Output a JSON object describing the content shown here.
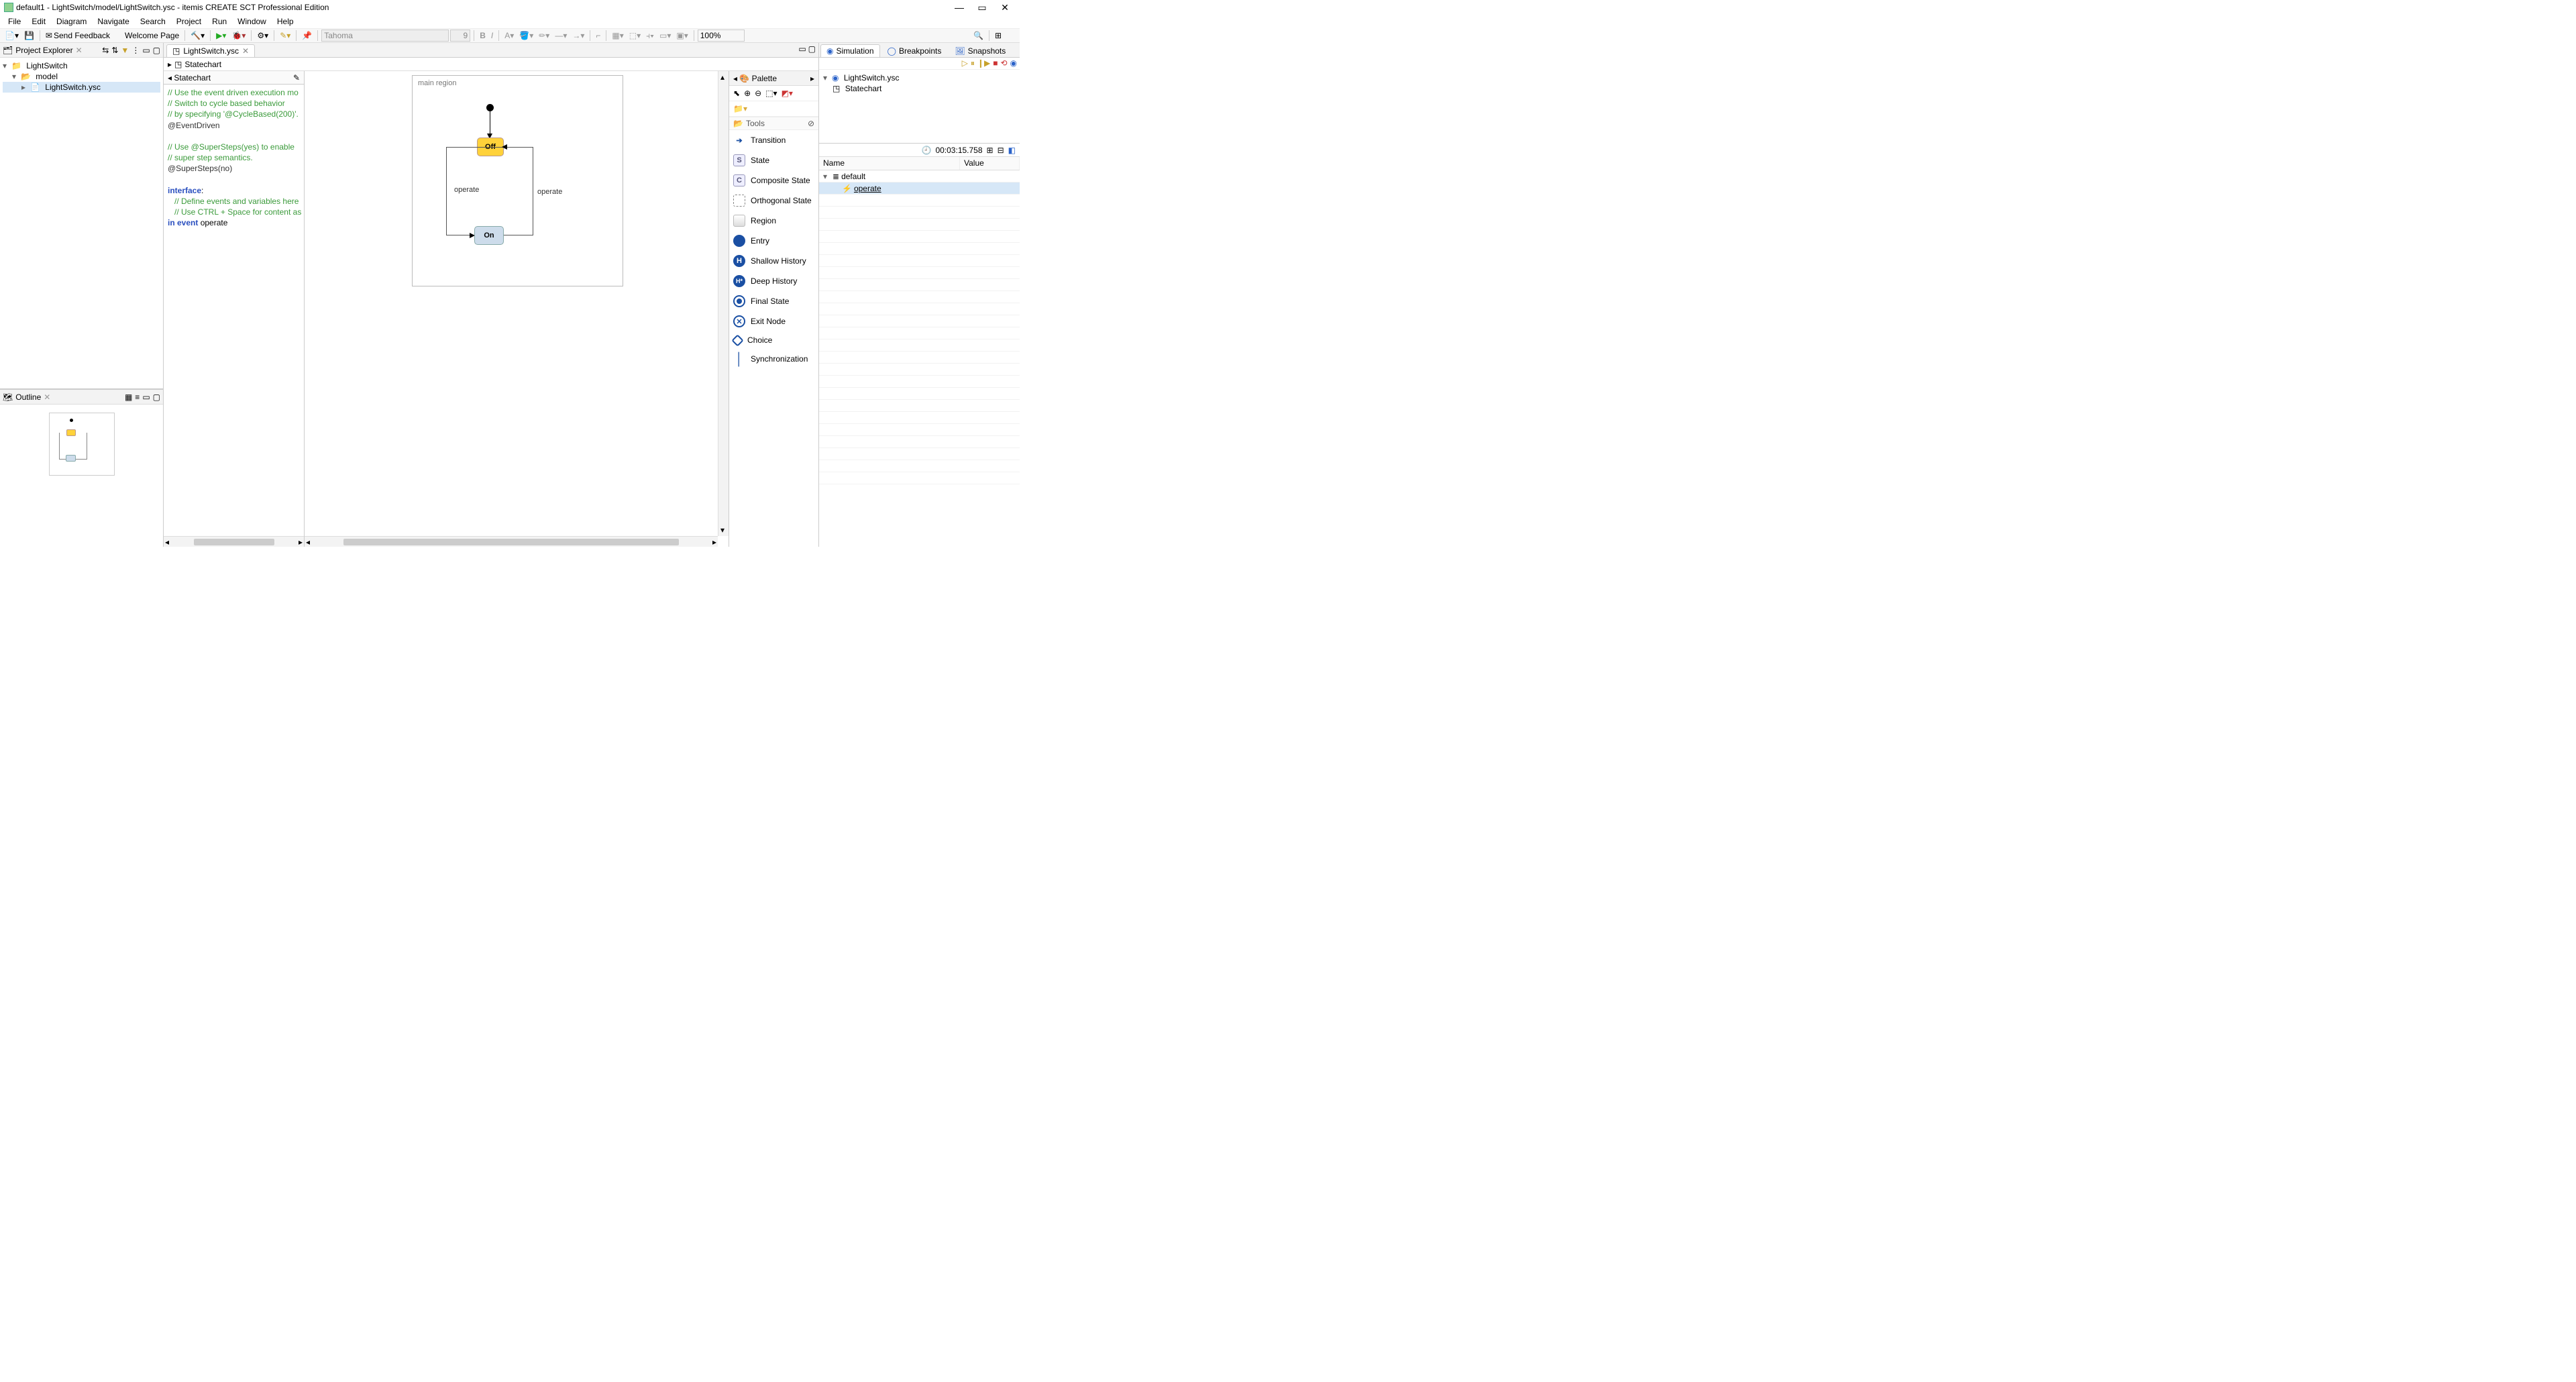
{
  "window": {
    "title": "default1 - LightSwitch/model/LightSwitch.ysc - itemis CREATE SCT Professional Edition",
    "min": "—",
    "max": "▭",
    "close": "✕"
  },
  "menu": {
    "items": [
      "File",
      "Edit",
      "Diagram",
      "Navigate",
      "Search",
      "Project",
      "Run",
      "Window",
      "Help"
    ]
  },
  "toolbar": {
    "send_feedback": "Send Feedback",
    "welcome_page": "Welcome Page",
    "font_name": "Tahoma",
    "font_size": "9",
    "zoom": "100%"
  },
  "project_explorer": {
    "title": "Project Explorer",
    "root": "LightSwitch",
    "folder": "model",
    "file": "LightSwitch.ysc"
  },
  "outline": {
    "title": "Outline"
  },
  "editor": {
    "tab": "LightSwitch.ysc",
    "breadcrumb": "Statechart",
    "def_title": "Statechart",
    "code": {
      "c1": "// Use the event driven execution mo",
      "c2": "// Switch to cycle based behavior",
      "c3": "// by specifying '@CycleBased(200)'.",
      "a1": "@EventDriven",
      "c4": "// Use @SuperSteps(yes) to enable",
      "c5": "// super step semantics.",
      "a2": "@SuperSteps(no)",
      "k1": "interface",
      "colon": ":",
      "c6": "   // Define events and variables here",
      "c7": "   // Use CTRL + Space for content as",
      "k2": "in event",
      "ev": " operate"
    }
  },
  "diagram": {
    "region_title": "main region",
    "state_off": "Off",
    "state_on": "On",
    "label_left": "operate",
    "label_right": "operate"
  },
  "palette": {
    "title": "Palette",
    "tools_title": "Tools",
    "items": [
      "Transition",
      "State",
      "Composite State",
      "Orthogonal State",
      "Region",
      "Entry",
      "Shallow History",
      "Deep History",
      "Final State",
      "Exit Node",
      "Choice",
      "Synchronization"
    ]
  },
  "right": {
    "tabs": {
      "sim": "Simulation",
      "bp": "Breakpoints",
      "snap": "Snapshots"
    },
    "tree_root": "LightSwitch.ysc",
    "tree_child": "Statechart",
    "clock": "00:03:15.758",
    "col_name": "Name",
    "col_value": "Value",
    "row_default": "default",
    "row_operate": "operate"
  }
}
